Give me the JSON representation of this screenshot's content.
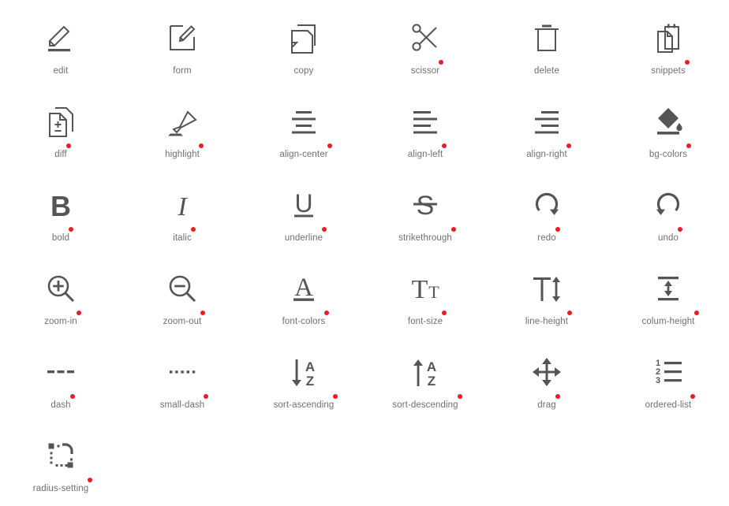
{
  "page": {
    "title": "Icon Gallery",
    "background_color": "#ffffff",
    "icon_color": "#555555",
    "label_color": "#6f6f6f",
    "marker_color": "#ee1b24",
    "columns": 6,
    "rows": 6,
    "total_icons": 31
  },
  "icons": [
    {
      "name": "edit",
      "label": "edit",
      "marker": false,
      "glyph": "pencil-underline-icon"
    },
    {
      "name": "form",
      "label": "form",
      "marker": false,
      "glyph": "square-pencil-icon"
    },
    {
      "name": "copy",
      "label": "copy",
      "marker": false,
      "glyph": "copy-pages-icon"
    },
    {
      "name": "scissor",
      "label": "scissor",
      "marker": true,
      "glyph": "scissors-icon"
    },
    {
      "name": "delete",
      "label": "delete",
      "marker": false,
      "glyph": "trash-can-icon"
    },
    {
      "name": "snippets",
      "label": "snippets",
      "marker": true,
      "glyph": "clipboard-pages-icon"
    },
    {
      "name": "diff",
      "label": "diff",
      "marker": true,
      "glyph": "documents-plus-minus-icon"
    },
    {
      "name": "highlight",
      "label": "highlight",
      "marker": true,
      "glyph": "highlighter-pen-icon"
    },
    {
      "name": "align-center",
      "label": "align-center",
      "marker": true,
      "glyph": "align-center-icon"
    },
    {
      "name": "align-left",
      "label": "align-left",
      "marker": true,
      "glyph": "align-left-icon"
    },
    {
      "name": "align-right",
      "label": "align-right",
      "marker": true,
      "glyph": "align-right-icon"
    },
    {
      "name": "bg-colors",
      "label": "bg-colors",
      "marker": true,
      "glyph": "paint-bucket-icon"
    },
    {
      "name": "bold",
      "label": "bold",
      "marker": true,
      "glyph": "letter-b-icon"
    },
    {
      "name": "italic",
      "label": "italic",
      "marker": true,
      "glyph": "letter-i-italic-icon"
    },
    {
      "name": "underline",
      "label": "underline",
      "marker": true,
      "glyph": "letter-u-underline-icon"
    },
    {
      "name": "strikethrough",
      "label": "strikethrough",
      "marker": true,
      "glyph": "letter-s-strike-icon"
    },
    {
      "name": "redo",
      "label": "redo",
      "marker": true,
      "glyph": "redo-arrow-icon"
    },
    {
      "name": "undo",
      "label": "undo",
      "marker": true,
      "glyph": "undo-arrow-icon"
    },
    {
      "name": "zoom-in",
      "label": "zoom-in",
      "marker": true,
      "glyph": "magnifier-plus-icon"
    },
    {
      "name": "zoom-out",
      "label": "zoom-out",
      "marker": true,
      "glyph": "magnifier-minus-icon"
    },
    {
      "name": "font-colors",
      "label": "font-colors",
      "marker": true,
      "glyph": "letter-a-underline-icon"
    },
    {
      "name": "font-size",
      "label": "font-size",
      "marker": true,
      "glyph": "big-t-small-t-icon"
    },
    {
      "name": "line-height",
      "label": "line-height",
      "marker": true,
      "glyph": "t-vertical-arrow-icon"
    },
    {
      "name": "colum-height",
      "label": "colum-height",
      "marker": true,
      "glyph": "vertical-arrow-bars-icon"
    },
    {
      "name": "dash",
      "label": "dash",
      "marker": true,
      "glyph": "dashed-line-icon"
    },
    {
      "name": "small-dash",
      "label": "small-dash",
      "marker": true,
      "glyph": "dotted-line-icon"
    },
    {
      "name": "sort-ascending",
      "label": "sort-ascending",
      "marker": true,
      "glyph": "arrow-down-az-icon"
    },
    {
      "name": "sort-descending",
      "label": "sort-descending",
      "marker": true,
      "glyph": "arrow-up-az-icon"
    },
    {
      "name": "drag",
      "label": "drag",
      "marker": true,
      "glyph": "four-way-arrows-icon"
    },
    {
      "name": "ordered-list",
      "label": "ordered-list",
      "marker": true,
      "glyph": "numbered-list-icon"
    },
    {
      "name": "radius-setting",
      "label": "radius-setting",
      "marker": true,
      "glyph": "corner-radius-icon"
    }
  ]
}
